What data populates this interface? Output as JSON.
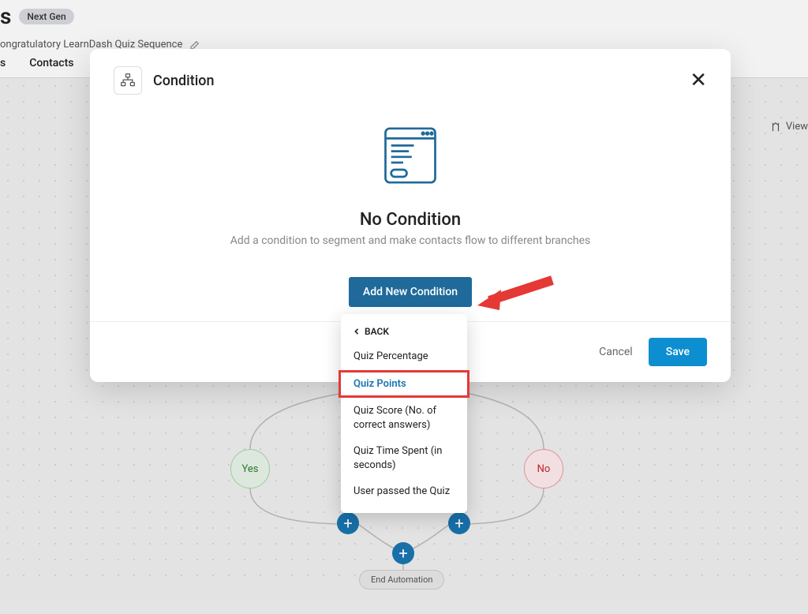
{
  "header": {
    "title_partial": "s",
    "badge": "Next Gen",
    "subtitle_partial": "ongratulatory LearnDash Quiz Sequence"
  },
  "tabs": {
    "tab1_partial": "s",
    "tab2": "Contacts"
  },
  "view_button": "View",
  "flow": {
    "yes": "Yes",
    "no": "No",
    "end": "End Automation"
  },
  "modal": {
    "title": "Condition",
    "body_title": "No Condition",
    "body_subtitle": "Add a condition to segment and make contacts flow to different branches",
    "add_button": "Add New Condition",
    "cancel": "Cancel",
    "save": "Save"
  },
  "dropdown": {
    "back": "BACK",
    "items": [
      "Quiz Percentage",
      "Quiz Points",
      "Quiz Score (No. of correct answers)",
      "Quiz Time Spent (in seconds)",
      "User passed the Quiz"
    ]
  }
}
